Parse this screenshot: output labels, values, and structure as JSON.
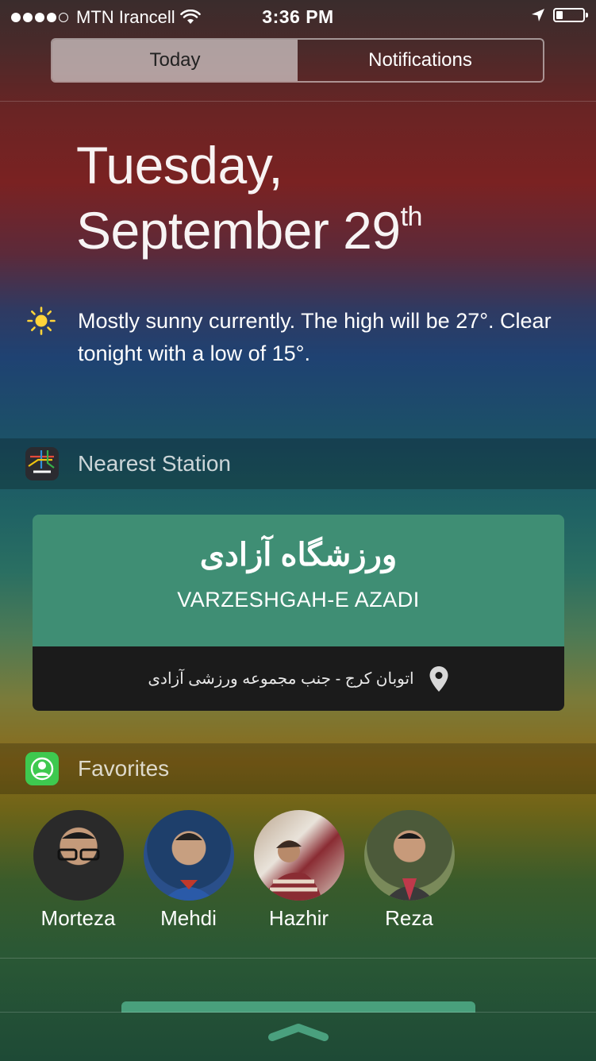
{
  "status_bar": {
    "carrier": "MTN Irancell",
    "time": "3:36 PM",
    "signal_bars_filled": 4,
    "signal_bars_total": 5,
    "icons": [
      "wifi-icon",
      "location-arrow-icon",
      "battery-icon"
    ],
    "battery_fraction": 0.25
  },
  "tabs": [
    {
      "label": "Today",
      "selected": true
    },
    {
      "label": "Notifications",
      "selected": false
    }
  ],
  "date": {
    "line1": "Tuesday,",
    "line2": "September 29",
    "ordinal_suffix": "th"
  },
  "weather": {
    "icon": "sun-icon",
    "summary": "Mostly sunny currently. The high will be 27°. Clear tonight with a low of 15°."
  },
  "nearest_station": {
    "section_title": "Nearest Station",
    "app_icon": "metro-app-icon",
    "station_name_fa": "ورزشگاه آزادی",
    "station_name_en": "VARZESHGAH-E AZADI",
    "address": "اتوبان کرج - جنب مجموعه ورزشی آزادی",
    "address_icon": "location-pin-icon",
    "colors": {
      "card": "#3f8e74",
      "footer": "#1b1b1b"
    }
  },
  "favorites": {
    "section_title": "Favorites",
    "app_icon": "contacts-icon",
    "contacts": [
      {
        "name": "Morteza"
      },
      {
        "name": "Mehdi"
      },
      {
        "name": "Hazhir"
      },
      {
        "name": "Reza"
      }
    ]
  },
  "bottom": {
    "grabber_icon": "chevron-up-icon"
  }
}
